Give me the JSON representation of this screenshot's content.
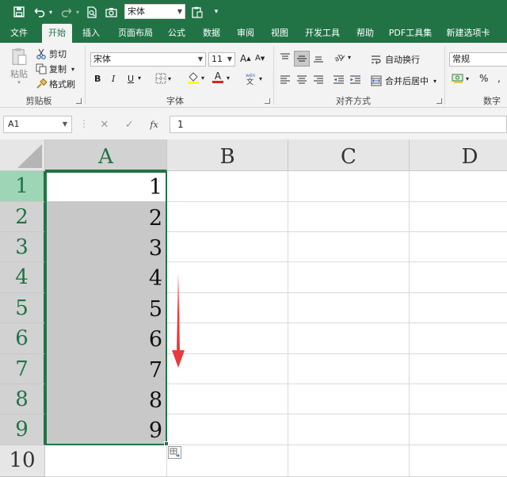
{
  "quick_access": {
    "font_value": "宋体"
  },
  "tabs": [
    "文件",
    "开始",
    "插入",
    "页面布局",
    "公式",
    "数据",
    "审阅",
    "视图",
    "开发工具",
    "帮助",
    "PDF工具集",
    "新建选项卡"
  ],
  "ribbon": {
    "clipboard": {
      "paste": "粘贴",
      "cut": "剪切",
      "copy": "复制",
      "format_painter": "格式刷",
      "group_label": "剪贴板"
    },
    "font": {
      "font_name": "宋体",
      "font_size": "11",
      "bold": "B",
      "italic": "I",
      "underline": "U",
      "font_color_glyph": "A",
      "group_label": "字体"
    },
    "alignment": {
      "wrap_text": "自动换行",
      "merge_center": "合并后居中",
      "group_label": "对齐方式"
    },
    "number": {
      "format": "常规",
      "percent": "%",
      "group_label": "数字"
    }
  },
  "formula_bar": {
    "name_box": "A1",
    "fx": "fx",
    "content": "1"
  },
  "sheet": {
    "columns": [
      "A",
      "B",
      "C",
      "D"
    ],
    "rows": [
      "1",
      "2",
      "3",
      "4",
      "5",
      "6",
      "7",
      "8",
      "9",
      "10"
    ],
    "cells_A": [
      "1",
      "2",
      "3",
      "4",
      "5",
      "6",
      "7",
      "8",
      "9",
      ""
    ]
  },
  "colors": {
    "accent": "#217346",
    "selection_fill": "#c8c8c8",
    "arrow": "#e8393f"
  }
}
